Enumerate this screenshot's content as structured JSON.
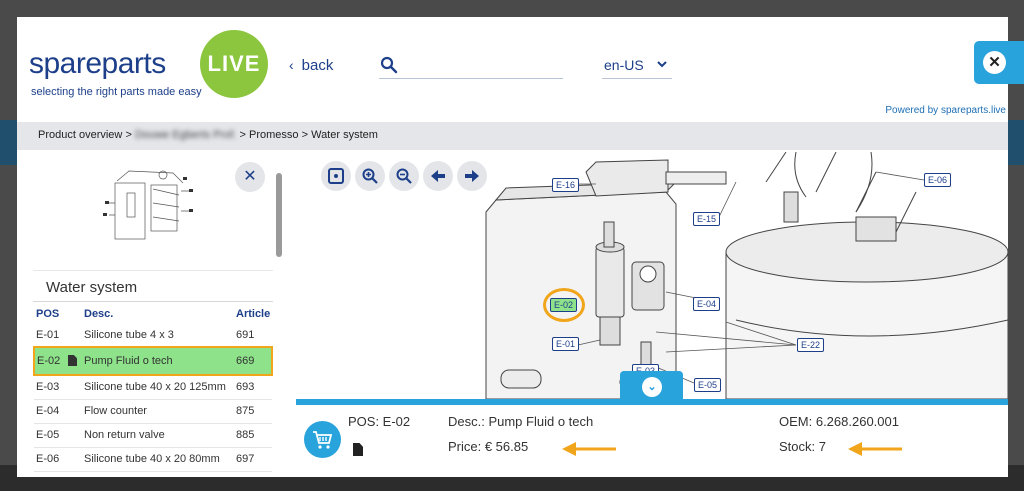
{
  "app": {
    "logo_word": "spareparts",
    "logo_badge": "LIVE",
    "tagline": "selecting the right parts made easy",
    "powered_by": "Powered by spareparts.live"
  },
  "header": {
    "back_label": "back",
    "search": {
      "value": "",
      "placeholder": ""
    },
    "language": "en-US"
  },
  "breadcrumb": {
    "items": [
      "Product overview",
      "Douwe Egberts Prof.",
      "Promesso",
      "Water system"
    ],
    "separator": ">"
  },
  "assembly": {
    "title": "Water system"
  },
  "parts_table": {
    "columns": [
      "POS",
      "Desc.",
      "Article"
    ],
    "rows": [
      {
        "pos": "E-01",
        "desc": "Silicone tube 4 x 3",
        "article": "691"
      },
      {
        "pos": "E-02",
        "desc": "Pump Fluid o tech",
        "article": "669"
      },
      {
        "pos": "E-03",
        "desc": "Silicone tube 40 x 20 125mm",
        "article": "693"
      },
      {
        "pos": "E-04",
        "desc": "Flow counter",
        "article": "875"
      },
      {
        "pos": "E-05",
        "desc": "Non return valve",
        "article": "885"
      },
      {
        "pos": "E-06",
        "desc": "Silicone tube 40 x 20 80mm",
        "article": "697"
      }
    ],
    "selected_pos": "E-02"
  },
  "diagram": {
    "callouts": [
      "E-16",
      "E-15",
      "E-06",
      "E-02",
      "E-04",
      "E-01",
      "E-22",
      "E-05",
      "E-03"
    ]
  },
  "detail": {
    "pos": "POS: E-02",
    "desc": "Desc.: Pump Fluid o tech",
    "price": "Price: € 56.85",
    "oem": "OEM: 6.268.260.001",
    "stock": "Stock: 7"
  },
  "colors": {
    "brand_blue": "#1d3f8a",
    "accent_blue": "#29a3dc",
    "brand_green": "#8cc63f",
    "selection_green": "#8ee28a",
    "highlight_orange": "#f0a51b"
  },
  "icons": [
    "chevron-left-icon",
    "search-icon",
    "chevron-down-icon",
    "close-icon",
    "fit-screen-icon",
    "zoom-in-icon",
    "zoom-out-icon",
    "arrow-left-icon",
    "arrow-right-icon",
    "document-icon",
    "cart-icon"
  ]
}
